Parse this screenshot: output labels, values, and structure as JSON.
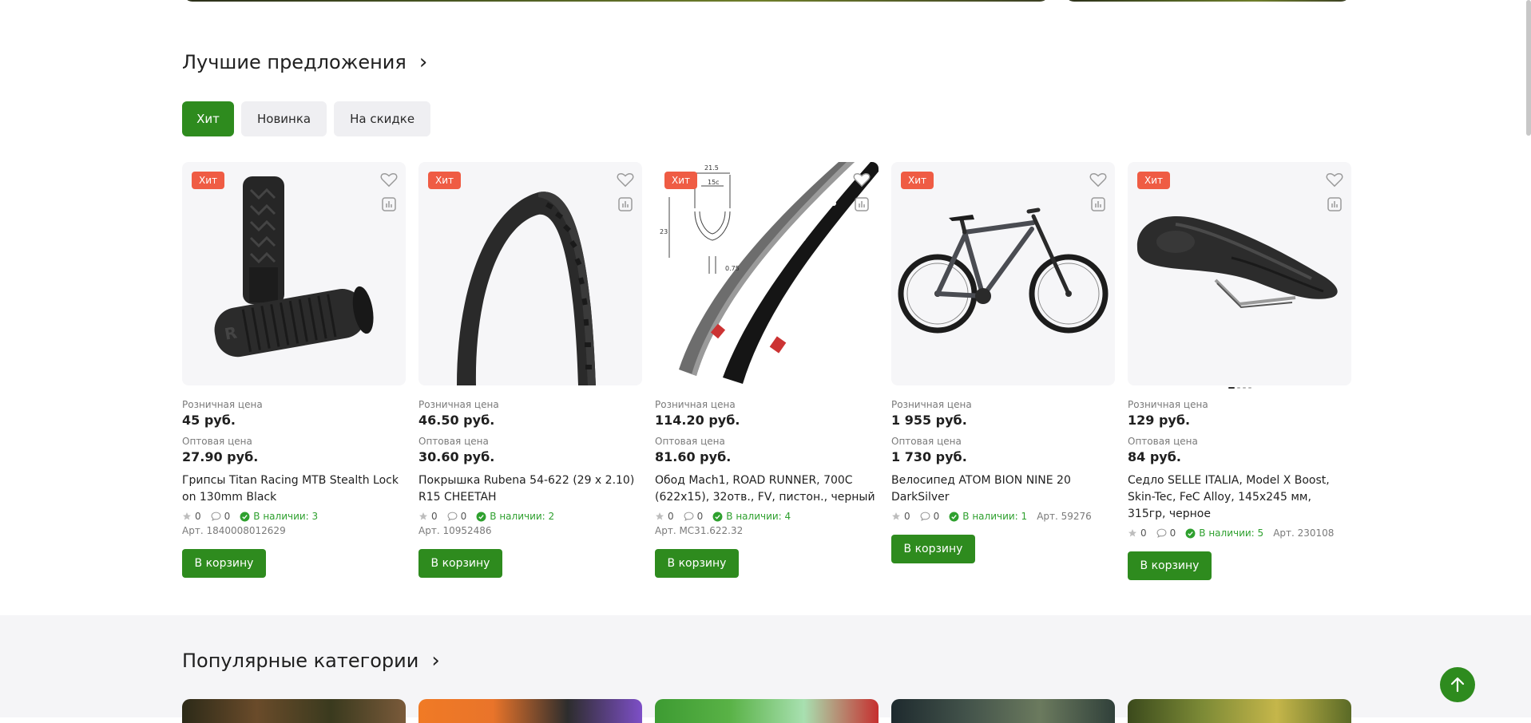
{
  "best_offers": {
    "title": "Лучшие предложения"
  },
  "tabs": [
    {
      "label": "Хит"
    },
    {
      "label": "Новинка"
    },
    {
      "label": "На скидке"
    }
  ],
  "colors": {
    "accent": "#2e8b1e",
    "badge": "#ef5c44",
    "stock": "#2ea02e"
  },
  "icons": {
    "favorite": "heart-icon",
    "compare": "compare-icon",
    "rating": "star-icon",
    "comments": "comment-icon",
    "stock": "check-circle-icon",
    "scroll": "arrow-up-icon",
    "section_more": "chevron-right-icon"
  },
  "products": [
    {
      "badge": "Хит",
      "retail_label": "Розничная цена",
      "retail_price": "45 руб.",
      "wholesale_label": "Оптовая цена",
      "wholesale_price": "27.90 руб.",
      "name": "Грипсы Titan Racing MTB Stealth Lock on 130mm Black",
      "rating": "0",
      "comments": "0",
      "stock": "В наличии: 3",
      "article": "Арт. 1840008012629",
      "cart": "В корзину"
    },
    {
      "badge": "Хит",
      "retail_label": "Розничная цена",
      "retail_price": "46.50 руб.",
      "wholesale_label": "Оптовая цена",
      "wholesale_price": "30.60 руб.",
      "name": "Покрышка Rubena 54-622 (29 x 2.10) R15 CHEETAH",
      "rating": "0",
      "comments": "0",
      "stock": "В наличии: 2",
      "article": "Арт. 10952486",
      "cart": "В корзину"
    },
    {
      "badge": "Хит",
      "retail_label": "Розничная цена",
      "retail_price": "114.20 руб.",
      "wholesale_label": "Оптовая цена",
      "wholesale_price": "81.60 руб.",
      "name": "Обод Mach1, ROAD RUNNER, 700C (622x15), 32отв., FV, пистон., черный",
      "rating": "0",
      "comments": "0",
      "stock": "В наличии: 4",
      "article": "Арт. MC31.622.32",
      "cart": "В корзину",
      "diagram": {
        "top": "21.5",
        "inner": "15c",
        "height": "23",
        "bottom": "0.75"
      }
    },
    {
      "badge": "Хит",
      "retail_label": "Розничная цена",
      "retail_price": "1 955 руб.",
      "wholesale_label": "Оптовая цена",
      "wholesale_price": "1 730 руб.",
      "name": "Велосипед ATOM BION NINE 20 DarkSilver",
      "rating": "0",
      "comments": "0",
      "stock": "В наличии: 1",
      "article": "Арт. 59276",
      "cart": "В корзину"
    },
    {
      "badge": "Хит",
      "retail_label": "Розничная цена",
      "retail_price": "129 руб.",
      "wholesale_label": "Оптовая цена",
      "wholesale_price": "84 руб.",
      "name": "Седло SELLE ITALIA, Model X Boost, Skin-Tec, FeC Alloy, 145x245 мм, 315гр, черное",
      "rating": "0",
      "comments": "0",
      "stock": "В наличии: 5",
      "article": "Арт. 230108",
      "cart": "В корзину"
    }
  ],
  "popular": {
    "title": "Популярные категории"
  }
}
